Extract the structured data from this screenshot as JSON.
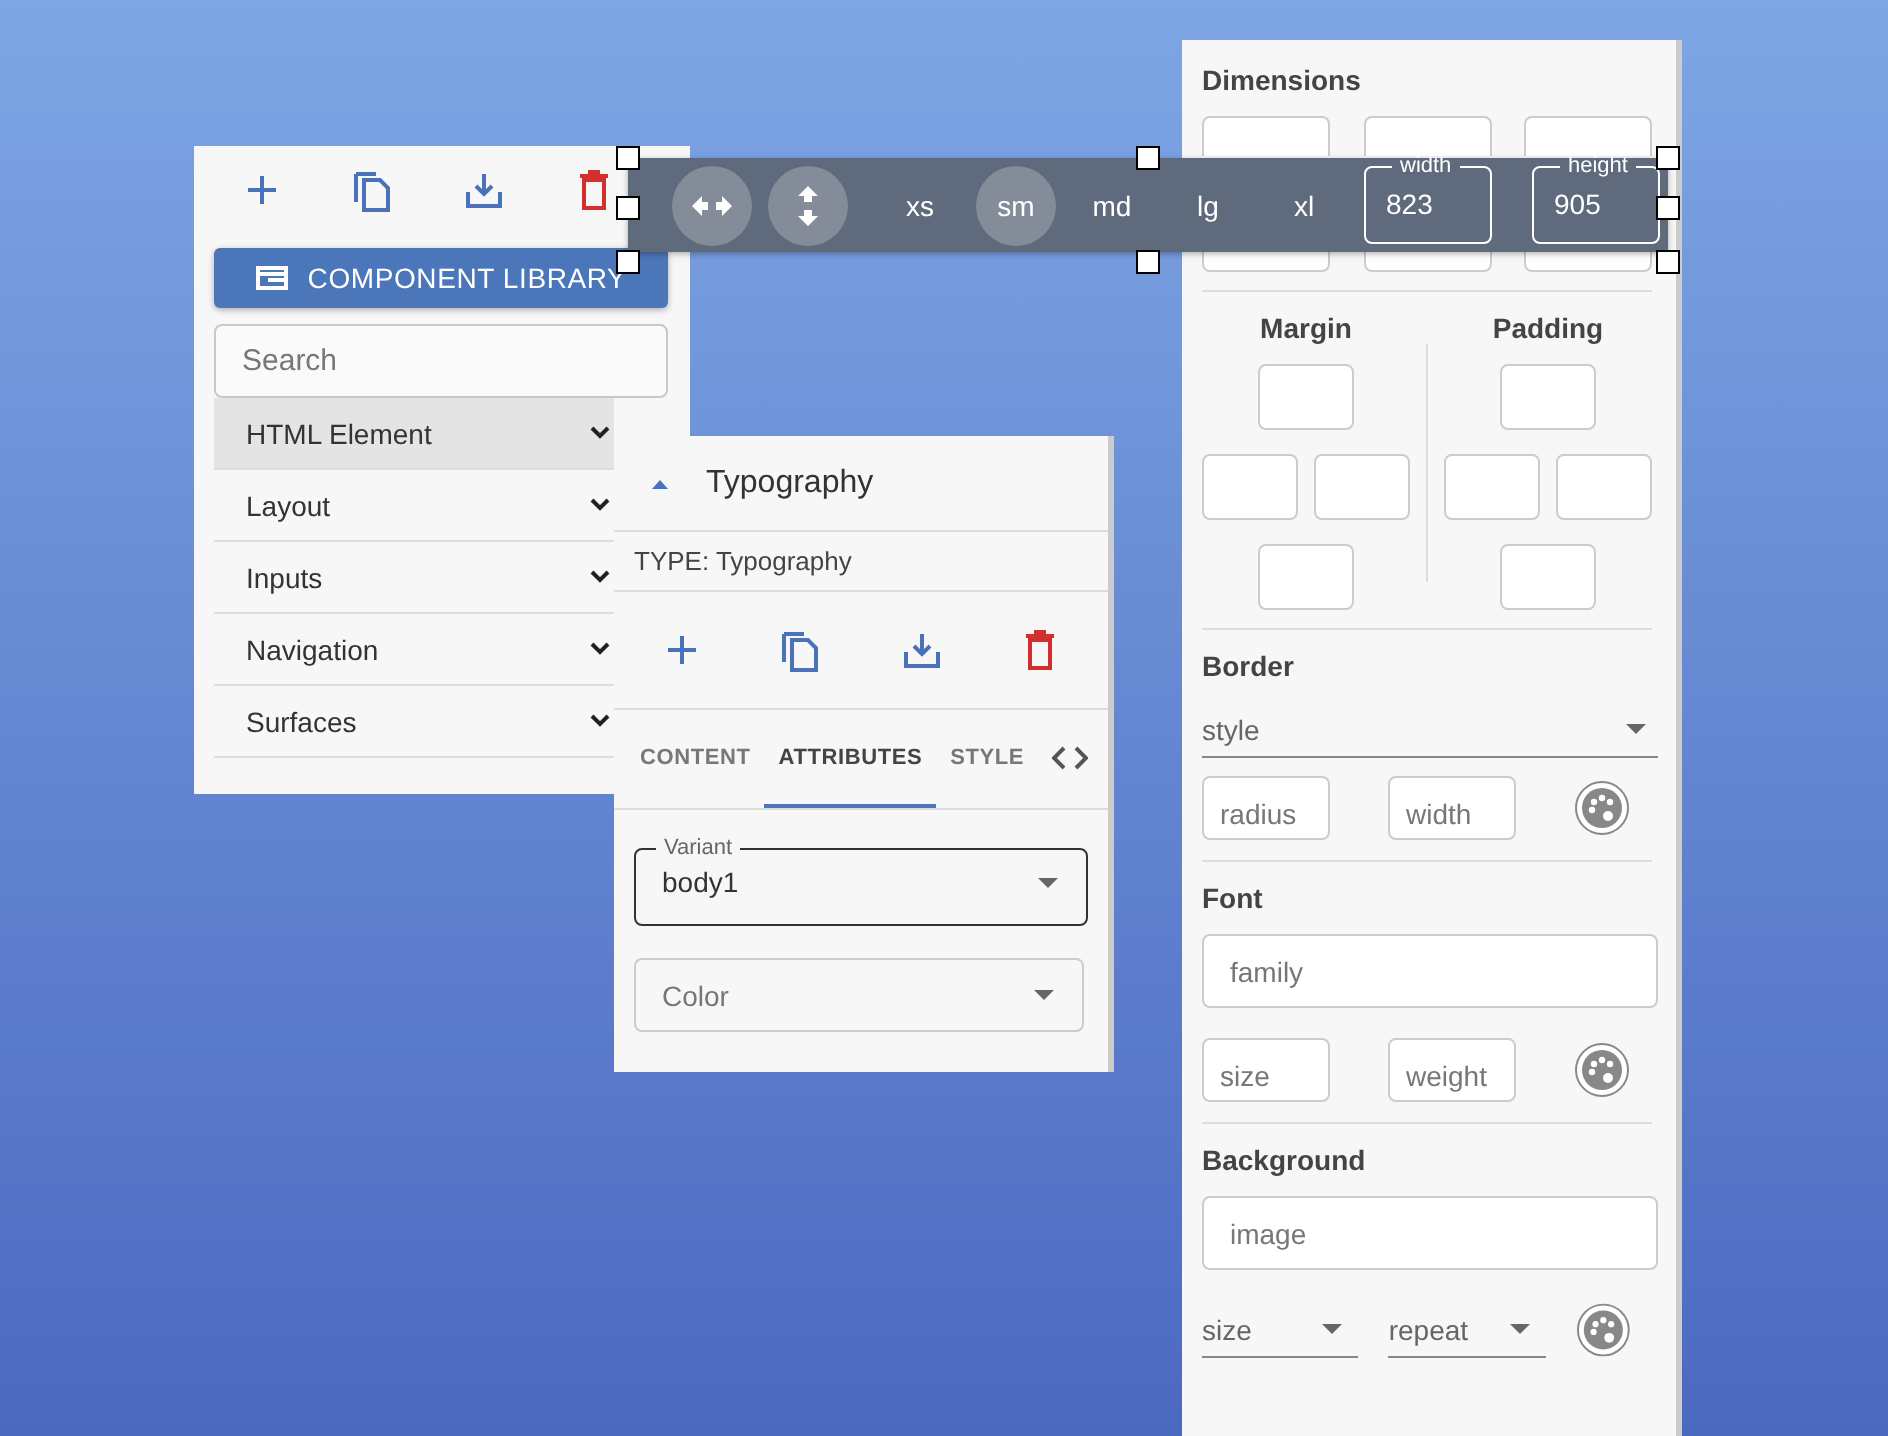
{
  "library_panel": {
    "button": "COMPONENT LIBRARY",
    "search": {
      "placeholder": "Search"
    },
    "categories": [
      {
        "label": "HTML Element",
        "selected": true
      },
      {
        "label": "Layout",
        "selected": false
      },
      {
        "label": "Inputs",
        "selected": false
      },
      {
        "label": "Navigation",
        "selected": false
      },
      {
        "label": "Surfaces",
        "selected": false
      }
    ]
  },
  "breakpoint_toolbar": {
    "breakpoints": [
      {
        "label": "xs",
        "selected": false
      },
      {
        "label": "sm",
        "selected": true
      },
      {
        "label": "md",
        "selected": false
      },
      {
        "label": "lg",
        "selected": false
      },
      {
        "label": "xl",
        "selected": false
      }
    ],
    "width": {
      "label": "width",
      "value": "823"
    },
    "height": {
      "label": "height",
      "value": "905"
    }
  },
  "component_panel": {
    "title": "Typography",
    "type": "TYPE: Typography",
    "tabs": [
      {
        "kind": "text",
        "label": "CONTENT",
        "selected": false
      },
      {
        "kind": "text",
        "label": "ATTRIBUTES",
        "selected": true
      },
      {
        "kind": "text",
        "label": "STYLE",
        "selected": false
      },
      {
        "kind": "code",
        "selected": false
      }
    ],
    "variant": {
      "label": "Variant",
      "value": "body1"
    },
    "color": {
      "placeholder": "Color"
    }
  },
  "style_panel": {
    "dimensions": {
      "title": "Dimensions"
    },
    "margin": {
      "title": "Margin"
    },
    "padding": {
      "title": "Padding"
    },
    "border": {
      "title": "Border",
      "style": {
        "placeholder": "style"
      },
      "radius": {
        "placeholder": "radius"
      },
      "width": {
        "placeholder": "width"
      }
    },
    "font": {
      "title": "Font",
      "family": {
        "placeholder": "family"
      },
      "size": {
        "placeholder": "size"
      },
      "weight": {
        "placeholder": "weight"
      }
    },
    "background": {
      "title": "Background",
      "image": {
        "placeholder": "image"
      },
      "size": {
        "placeholder": "size"
      },
      "repeat": {
        "placeholder": "repeat"
      }
    }
  }
}
